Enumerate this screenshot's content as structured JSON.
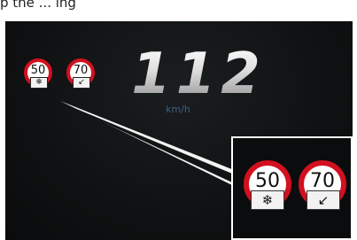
{
  "caption": "p the ... ing",
  "speed": {
    "value": "112",
    "unit": "km/h"
  },
  "signs": [
    {
      "limit": "50",
      "plate_symbol": "❄",
      "plate_icon": "snowflake-icon"
    },
    {
      "limit": "70",
      "plate_symbol": "↙",
      "plate_icon": "arrow-down-left-icon"
    }
  ],
  "colors": {
    "background": "#0f1112",
    "sign_ring": "#d3101f",
    "unit_text": "#3c5f86",
    "callout_border": "#ffffff"
  }
}
